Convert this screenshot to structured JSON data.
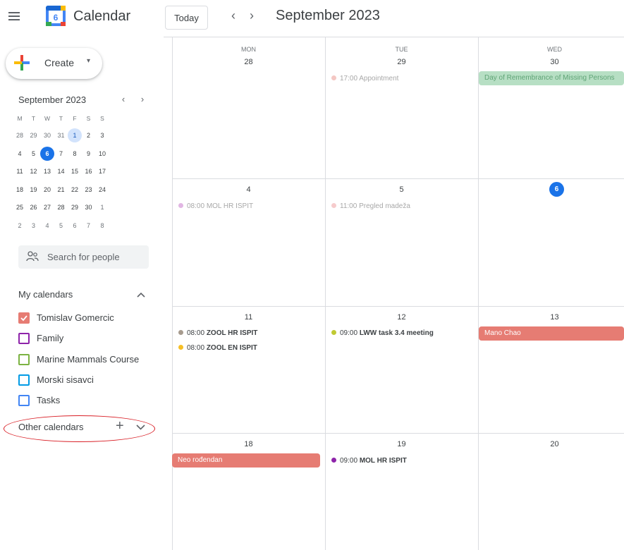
{
  "header": {
    "app_title": "Calendar",
    "logo_number": "6",
    "today_label": "Today",
    "prev_icon": "chevron-left-icon",
    "next_icon": "chevron-right-icon",
    "prev_glyph": "‹",
    "next_glyph": "›",
    "month_title": "September 2023"
  },
  "sidebar": {
    "create_label": "Create",
    "create_caret": "▾",
    "mini_month_title": "September 2023",
    "mini_prev": "‹",
    "mini_next": "›",
    "weekday_headers": [
      "M",
      "T",
      "W",
      "T",
      "F",
      "S",
      "S"
    ],
    "mini_weeks": [
      [
        "28",
        "29",
        "30",
        "31",
        "1",
        "2",
        "3"
      ],
      [
        "4",
        "5",
        "6",
        "7",
        "8",
        "9",
        "10"
      ],
      [
        "11",
        "12",
        "13",
        "14",
        "15",
        "16",
        "17"
      ],
      [
        "18",
        "19",
        "20",
        "21",
        "22",
        "23",
        "24"
      ],
      [
        "25",
        "26",
        "27",
        "28",
        "29",
        "30",
        "1"
      ],
      [
        "2",
        "3",
        "4",
        "5",
        "6",
        "7",
        "8"
      ]
    ],
    "search_people_placeholder": "Search for people",
    "my_calendars_title": "My calendars",
    "my_calendars_toggle": "^",
    "calendars": [
      {
        "label": "Tomislav Gomercic",
        "color": "#e67c73",
        "checked": true
      },
      {
        "label": "Family",
        "color": "#8e24aa",
        "checked": false
      },
      {
        "label": "Marine Mammals Course",
        "color": "#7cb342",
        "checked": false
      },
      {
        "label": "Morski sisavci",
        "color": "#039be5",
        "checked": false
      },
      {
        "label": "Tasks",
        "color": "#4285f4",
        "checked": false
      }
    ],
    "other_calendars_title": "Other calendars",
    "other_add": "+",
    "other_toggle": "⌄"
  },
  "grid": {
    "columns": [
      {
        "dow": "MON",
        "day": "28"
      },
      {
        "dow": "TUE",
        "day": "29"
      },
      {
        "dow": "WED",
        "day": "30"
      }
    ],
    "rows": [
      [
        "4",
        "5",
        "6"
      ],
      [
        "11",
        "12",
        "13"
      ],
      [
        "18",
        "19",
        "20"
      ]
    ],
    "events": {
      "e1": {
        "time": "17:00",
        "title": "Appointment",
        "color": "#f4c7c3"
      },
      "e2": {
        "title": "Day of Remembrance of Missing Persons",
        "color": "#b7dfc4",
        "text_color": "#5fa476"
      },
      "e3": {
        "time": "08:00",
        "title": "MOL HR ISPIT",
        "color": "#e1b6e3"
      },
      "e4": {
        "time": "11:00",
        "title": "Pregled madeža",
        "color": "#f6cbcc"
      },
      "e5": {
        "time": "08:00",
        "title": "ZOOL HR ISPIT",
        "color": "#a79b8e"
      },
      "e6": {
        "time": "08:00",
        "title": "ZOOL EN ISPIT",
        "color": "#f6bf26"
      },
      "e7": {
        "time": "09:00",
        "title": "LWW task 3.4 meeting",
        "color": "#c0ca33"
      },
      "e8": {
        "title": "Mano Chao",
        "color": "#e67c73"
      },
      "e9": {
        "title": "Neo rođendan",
        "color": "#e67c73"
      },
      "e10": {
        "time": "09:00",
        "title": "MOL HR ISPIT",
        "color": "#8e24aa"
      }
    }
  }
}
